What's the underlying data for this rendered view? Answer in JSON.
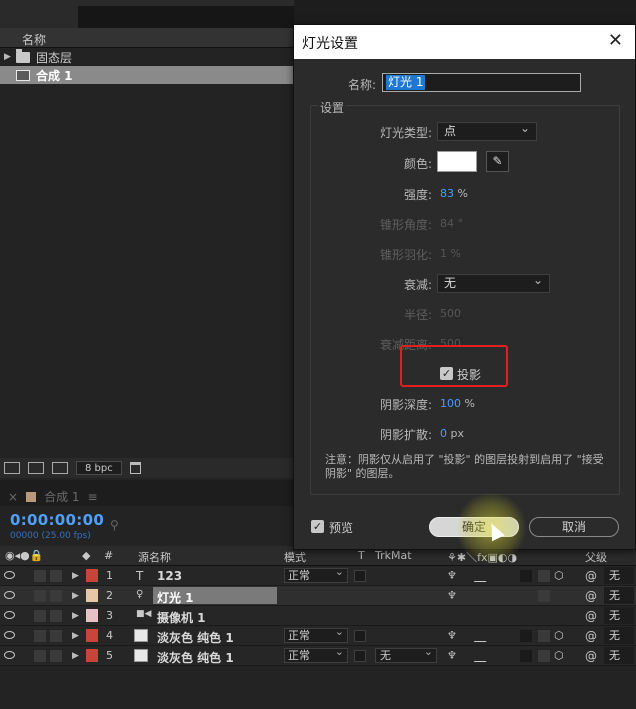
{
  "project": {
    "column_name": "名称",
    "items": [
      {
        "label": "固态层",
        "icon": "folder-icon"
      },
      {
        "label": "合成 1",
        "icon": "composition-icon"
      }
    ],
    "bpc": "8 bpc"
  },
  "timeline": {
    "tab_label": "合成 1",
    "timecode": "0:00:00:00",
    "timecode_sub": "00000 (25.00 fps)",
    "headers": {
      "num": "#",
      "source": "源名称",
      "mode": "模式",
      "t": "T",
      "trkmat": "TrkMat",
      "parent": "父级"
    },
    "layers": [
      {
        "num": "1",
        "type": "T",
        "name": "123",
        "mode": "正常",
        "trkmat": "",
        "parent": "无",
        "color": "#c8453c"
      },
      {
        "num": "2",
        "type": "💡",
        "name": "灯光 1",
        "mode": "",
        "trkmat": "",
        "parent": "无",
        "color": "#e6c8a8"
      },
      {
        "num": "3",
        "type": "■◀",
        "name": "摄像机 1",
        "mode": "",
        "trkmat": "",
        "parent": "无",
        "color": "#e8c0c8"
      },
      {
        "num": "4",
        "type": "",
        "name": "淡灰色 纯色 1",
        "mode": "正常",
        "trkmat": "",
        "parent": "无",
        "color": "#c8453c"
      },
      {
        "num": "5",
        "type": "",
        "name": "淡灰色 纯色 1",
        "mode": "正常",
        "trkmat": "无",
        "parent": "无",
        "color": "#c8453c"
      }
    ]
  },
  "dialog": {
    "title": "灯光设置",
    "name_label": "名称:",
    "name_value": "灯光 1",
    "group_title": "设置",
    "light_type_label": "灯光类型:",
    "light_type_value": "点",
    "color_label": "颜色:",
    "color_value": "#ffffff",
    "intensity_label": "强度:",
    "intensity_value": "83",
    "intensity_unit": "%",
    "cone_angle_label": "锥形角度:",
    "cone_angle_value": "84",
    "cone_angle_unit": "°",
    "cone_feather_label": "锥形羽化:",
    "cone_feather_value": "1",
    "cone_feather_unit": "%",
    "falloff_label": "衰减:",
    "falloff_value": "无",
    "radius_label": "半径:",
    "radius_value": "500",
    "falloff_distance_label": "衰减距离:",
    "falloff_distance_value": "500",
    "casts_shadows_label": "投影",
    "shadow_darkness_label": "阴影深度:",
    "shadow_darkness_value": "100",
    "shadow_darkness_unit": "%",
    "shadow_diffusion_label": "阴影扩散:",
    "shadow_diffusion_value": "0",
    "shadow_diffusion_unit": "px",
    "note": "注意：阴影仅从启用了 \"投影\" 的图层投射到启用了 \"接受阴影\" 的图层。",
    "preview_label": "预览",
    "ok_label": "确定",
    "cancel_label": "取消"
  },
  "colors": {
    "accent": "#4b9cff",
    "highlight_box": "#e02020",
    "selection": "#1e77d0"
  }
}
